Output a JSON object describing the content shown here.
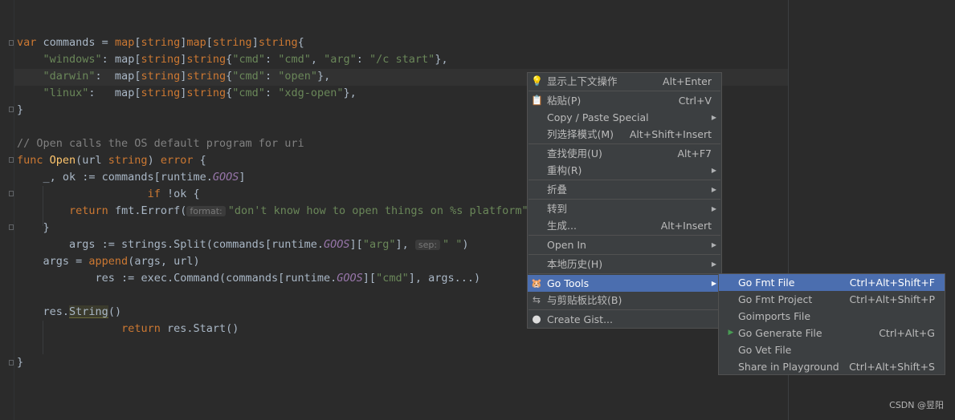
{
  "editor": {
    "lines": [
      {
        "indent": 0,
        "tokens": [
          [
            "kw",
            "var"
          ],
          [
            "t",
            " commands = "
          ],
          [
            "kw",
            "map"
          ],
          [
            "t",
            "["
          ],
          [
            "kw",
            "string"
          ],
          [
            "t",
            "]"
          ],
          [
            "kw",
            "map"
          ],
          [
            "t",
            "["
          ],
          [
            "kw",
            "string"
          ],
          [
            "t",
            "]"
          ],
          [
            "kw",
            "string"
          ],
          [
            "t",
            "{"
          ]
        ]
      },
      {
        "indent": 4,
        "tokens": [
          [
            "str",
            "\"windows\""
          ],
          [
            "t",
            ": "
          ],
          [
            "t",
            "map"
          ],
          [
            "t",
            "["
          ],
          [
            "kw",
            "string"
          ],
          [
            "t",
            "]"
          ],
          [
            "kw",
            "string"
          ],
          [
            "t",
            "{"
          ],
          [
            "str",
            "\"cmd\""
          ],
          [
            "t",
            ": "
          ],
          [
            "str",
            "\"cmd\""
          ],
          [
            "t",
            ", "
          ],
          [
            "str",
            "\"arg\""
          ],
          [
            "t",
            ": "
          ],
          [
            "str",
            "\"/c start\""
          ],
          [
            "t",
            "},"
          ]
        ]
      },
      {
        "indent": 4,
        "tokens": [
          [
            "str",
            "\"darwin\""
          ],
          [
            "t",
            ":  map["
          ],
          [
            "kw",
            "string"
          ],
          [
            "t",
            "]"
          ],
          [
            "kw",
            "string"
          ],
          [
            "t",
            "{"
          ],
          [
            "str",
            "\"cmd\""
          ],
          [
            "t",
            ": "
          ],
          [
            "str",
            "\"open\""
          ],
          [
            "t",
            "},"
          ]
        ]
      },
      {
        "indent": 4,
        "tokens": [
          [
            "str",
            "\"linux\""
          ],
          [
            "t",
            ":   map["
          ],
          [
            "kw",
            "string"
          ],
          [
            "t",
            "]"
          ],
          [
            "kw",
            "string"
          ],
          [
            "t",
            "{"
          ],
          [
            "str",
            "\"cmd\""
          ],
          [
            "t",
            ": "
          ],
          [
            "str",
            "\"xdg-open\""
          ],
          [
            "t",
            "},"
          ]
        ]
      },
      {
        "indent": 0,
        "tokens": [
          [
            "t",
            "}"
          ]
        ]
      },
      {
        "indent": 0,
        "tokens": []
      },
      {
        "indent": 0,
        "tokens": [
          [
            "cm",
            "// Open calls the OS default program for uri"
          ]
        ]
      },
      {
        "indent": 0,
        "tokens": [
          [
            "kw",
            "func "
          ],
          [
            "fn",
            "Open"
          ],
          [
            "t",
            "(url "
          ],
          [
            "kw",
            "string"
          ],
          [
            "t",
            ") "
          ],
          [
            "kw",
            "error"
          ],
          [
            "t",
            " {"
          ]
        ]
      },
      {
        "indent": 4,
        "tokens": [
          [
            "t",
            "_, ok := commands["
          ],
          [
            "t",
            "runtime."
          ],
          [
            "it",
            "GOOS"
          ],
          [
            "t",
            "]"
          ]
        ]
      },
      {
        "indent": 20,
        "tokens": [
          [
            "kw",
            "if"
          ],
          [
            "t",
            " !ok {"
          ]
        ]
      },
      {
        "indent": 8,
        "tokens": [
          [
            "kw",
            "return"
          ],
          [
            "t",
            " fmt.Errorf("
          ],
          [
            "hint",
            "format:"
          ],
          [
            "str",
            "\"don't know how to open things on %s platform\""
          ],
          [
            "t",
            ","
          ]
        ]
      },
      {
        "indent": 4,
        "tokens": [
          [
            "t",
            "}"
          ]
        ]
      },
      {
        "indent": 8,
        "tokens": [
          [
            "t",
            "args := strings.Split(commands["
          ],
          [
            "t",
            "runtime."
          ],
          [
            "it",
            "GOOS"
          ],
          [
            "t",
            "]["
          ],
          [
            "str",
            "\"arg\""
          ],
          [
            "t",
            "], "
          ],
          [
            "hint",
            "sep:"
          ],
          [
            "str",
            "\" \""
          ],
          [
            "t",
            ")"
          ]
        ]
      },
      {
        "indent": 4,
        "tokens": [
          [
            "t",
            "args = "
          ],
          [
            "kw",
            "append"
          ],
          [
            "t",
            "(args, url)"
          ]
        ]
      },
      {
        "indent": 12,
        "tokens": [
          [
            "t",
            "res := exec.Command(commands["
          ],
          [
            "t",
            "runtime."
          ],
          [
            "it",
            "GOOS"
          ],
          [
            "t",
            "]["
          ],
          [
            "str",
            "\"cmd\""
          ],
          [
            "t",
            "], args...)"
          ]
        ]
      },
      {
        "indent": 0,
        "tokens": []
      },
      {
        "indent": 4,
        "tokens": [
          [
            "t",
            "res."
          ],
          [
            "hl",
            "String"
          ],
          [
            "t",
            "()"
          ]
        ]
      },
      {
        "indent": 16,
        "tokens": [
          [
            "kw",
            "return"
          ],
          [
            "t",
            " res.Start()"
          ]
        ]
      },
      {
        "indent": 0,
        "tokens": []
      },
      {
        "indent": 0,
        "tokens": [
          [
            "t",
            "}"
          ]
        ]
      }
    ]
  },
  "context_menu": {
    "items": [
      {
        "icon": "lightbulb-icon",
        "glyph": "💡",
        "label": "显示上下文操作",
        "shortcut": "Alt+Enter",
        "submenu": false
      },
      {
        "sep": true
      },
      {
        "icon": "clipboard-icon",
        "glyph": "📋",
        "label": "粘贴(P)",
        "shortcut": "Ctrl+V",
        "submenu": false
      },
      {
        "icon": "",
        "glyph": "",
        "label": "Copy / Paste Special",
        "shortcut": "",
        "submenu": true
      },
      {
        "icon": "",
        "glyph": "",
        "label": "列选择模式(M)",
        "shortcut": "Alt+Shift+Insert",
        "submenu": false
      },
      {
        "sep": true
      },
      {
        "icon": "",
        "glyph": "",
        "label": "查找使用(U)",
        "shortcut": "Alt+F7",
        "submenu": false
      },
      {
        "icon": "",
        "glyph": "",
        "label": "重构(R)",
        "shortcut": "",
        "submenu": true
      },
      {
        "sep": true
      },
      {
        "icon": "",
        "glyph": "",
        "label": "折叠",
        "shortcut": "",
        "submenu": true
      },
      {
        "sep": true
      },
      {
        "icon": "",
        "glyph": "",
        "label": "转到",
        "shortcut": "",
        "submenu": true
      },
      {
        "icon": "",
        "glyph": "",
        "label": "生成...",
        "shortcut": "Alt+Insert",
        "submenu": false
      },
      {
        "sep": true
      },
      {
        "icon": "",
        "glyph": "",
        "label": "Open In",
        "shortcut": "",
        "submenu": true
      },
      {
        "sep": true
      },
      {
        "icon": "",
        "glyph": "",
        "label": "本地历史(H)",
        "shortcut": "",
        "submenu": true
      },
      {
        "sep": true
      },
      {
        "icon": "go-gopher-icon",
        "glyph": "🐹",
        "label": "Go Tools",
        "shortcut": "",
        "submenu": true,
        "selected": true
      },
      {
        "icon": "compare-clipboard-icon",
        "glyph": "⇆",
        "label": "与剪贴板比较(B)",
        "shortcut": "",
        "submenu": false
      },
      {
        "sep": true
      },
      {
        "icon": "github-icon",
        "glyph": "●",
        "label": "Create Gist...",
        "shortcut": "",
        "submenu": false
      }
    ]
  },
  "go_tools_submenu": {
    "items": [
      {
        "icon": "",
        "glyph": "",
        "label": "Go Fmt File",
        "shortcut": "Ctrl+Alt+Shift+F",
        "selected": true
      },
      {
        "icon": "",
        "glyph": "",
        "label": "Go Fmt Project",
        "shortcut": "Ctrl+Alt+Shift+P"
      },
      {
        "icon": "",
        "glyph": "",
        "label": "Goimports File",
        "shortcut": ""
      },
      {
        "icon": "run-icon",
        "glyph": "▶",
        "label": "Go Generate File",
        "shortcut": "Ctrl+Alt+G"
      },
      {
        "icon": "",
        "glyph": "",
        "label": "Go Vet File",
        "shortcut": ""
      },
      {
        "icon": "",
        "glyph": "",
        "label": "Share in Playground",
        "shortcut": "Ctrl+Alt+Shift+S"
      }
    ]
  },
  "watermark": "CSDN @昱阳"
}
